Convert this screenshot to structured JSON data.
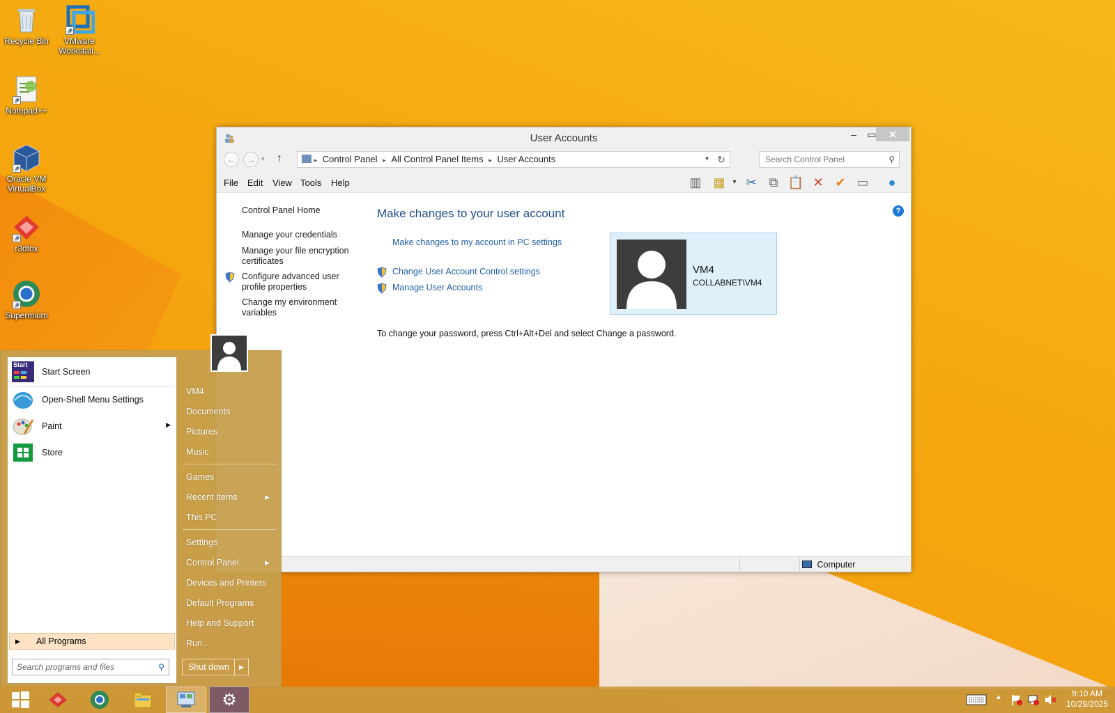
{
  "desktop": {
    "icons": [
      {
        "label": "Recycle Bin"
      },
      {
        "label": "VMware Workstati..."
      },
      {
        "label": "Notepad++"
      },
      {
        "label": "Oracle VM VirtualBox"
      },
      {
        "label": "r3dfox"
      },
      {
        "label": "Supermium"
      }
    ]
  },
  "window": {
    "title": "User Accounts",
    "address": {
      "crumbs": [
        "Control Panel",
        "All Control Panel Items",
        "User Accounts"
      ]
    },
    "search_placeholder": "Search Control Panel",
    "menu": [
      "File",
      "Edit",
      "View",
      "Tools",
      "Help"
    ],
    "left_pane": {
      "home": "Control Panel Home",
      "links": [
        "Manage your credentials",
        "Manage your file encryption certificates",
        "Configure advanced user profile properties",
        "Change my environment variables"
      ]
    },
    "content": {
      "heading": "Make changes to your user account",
      "pc_settings_link": "Make changes to my account in PC settings",
      "uac_link": "Change User Account Control settings",
      "manage_link": "Manage User Accounts",
      "account_name": "VM4",
      "account_domain": "COLLABNET\\VM4",
      "password_note": "To change your password, press Ctrl+Alt+Del and select Change a password."
    },
    "status": {
      "computer": "Computer"
    }
  },
  "start_menu": {
    "left_items": [
      "Start Screen",
      "Open-Shell Menu Settings",
      "Paint",
      "Store"
    ],
    "start_badge": "Start",
    "all_programs": "All Programs",
    "search_placeholder": "Search programs and files",
    "right_items": [
      "VM4",
      "Documents",
      "Pictures",
      "Music",
      "Games",
      "Recent Items",
      "This PC",
      "Settings",
      "Control Panel",
      "Devices and Printers",
      "Default Programs",
      "Help and Support",
      "Run..."
    ],
    "shutdown": "Shut down"
  },
  "taskbar": {
    "time": "9:10 AM",
    "date": "10/29/2025"
  },
  "colors": {
    "accent_link": "#1f5fa8",
    "heading": "#1e4e8c",
    "start_menu_bg": "#c69e4c",
    "taskbar_bg": "#c8963c"
  }
}
